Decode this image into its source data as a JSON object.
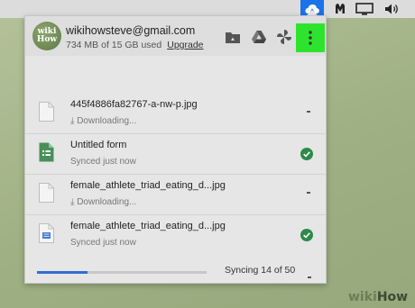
{
  "menubar": {
    "icons": [
      "google-drive-icon",
      "malwarebytes-icon",
      "display-icon",
      "volume-icon"
    ],
    "active_color": "#1a73e8"
  },
  "account": {
    "avatar_text_top": "wiki",
    "avatar_text_bottom": "How",
    "email": "wikihowsteve@gmail.com",
    "usage": "734 MB of 15 GB used",
    "upgrade_label": "Upgrade"
  },
  "header_actions": [
    "folder-icon",
    "google-drive-icon",
    "google-photos-icon",
    "more-vertical-icon"
  ],
  "highlight_color": "#2ee32e",
  "files": [
    {
      "name": "445f4886fa82767-a-nw-p.jpg",
      "status": "Downloading...",
      "state": "downloading",
      "type": "image"
    },
    {
      "name": "Untitled form",
      "status": "Synced just now",
      "state": "synced",
      "type": "form"
    },
    {
      "name": "female_athlete_triad_eating_d...jpg",
      "status": "Downloading...",
      "state": "downloading",
      "type": "image"
    },
    {
      "name": "female_athlete_triad_eating_d...jpg",
      "status": "Synced just now",
      "state": "synced",
      "type": "doc"
    }
  ],
  "footer": {
    "progress": 0.3,
    "sync_text": "Syncing 14 of 50"
  },
  "watermark": {
    "part1": "wiki",
    "part2": "How"
  }
}
